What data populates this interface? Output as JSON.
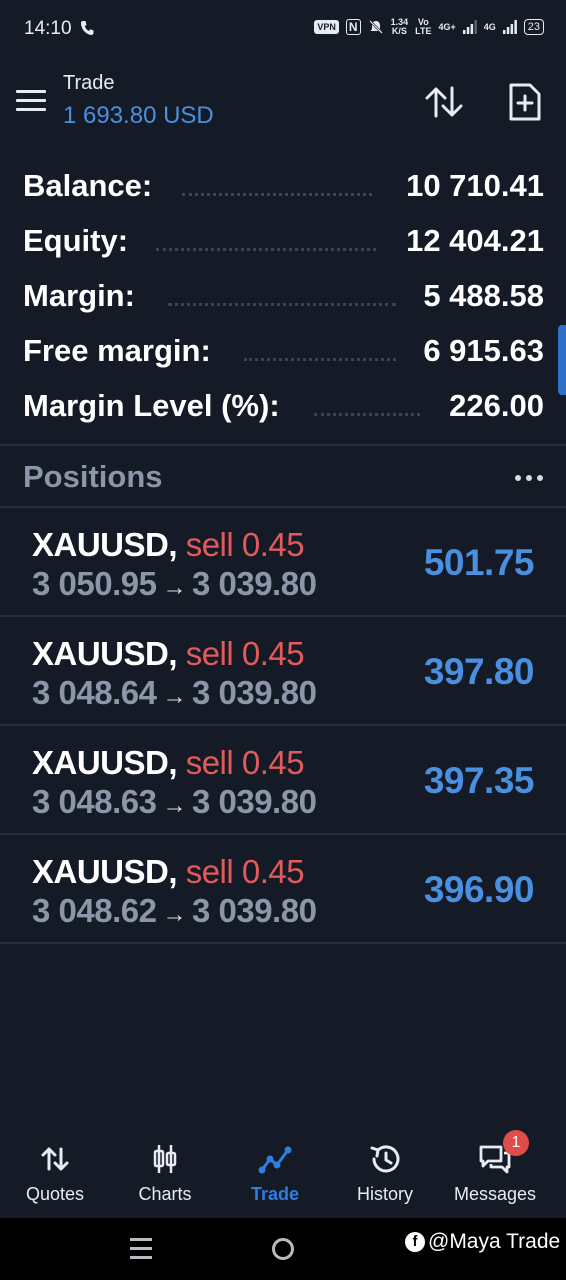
{
  "status_bar": {
    "time": "14:10",
    "vpn": "VPN",
    "nfc": "N",
    "speed_value": "1.34",
    "speed_unit": "K/S",
    "volte_top": "Vo",
    "volte_bottom": "LTE",
    "network_1": "4G+",
    "network_2": "4G",
    "battery": "23"
  },
  "header": {
    "title": "Trade",
    "subtitle": "1 693.80 USD"
  },
  "summary": [
    {
      "label": "Balance:",
      "value": "10 710.41"
    },
    {
      "label": "Equity:",
      "value": "12 404.21"
    },
    {
      "label": "Margin:",
      "value": "5 488.58"
    },
    {
      "label": "Free margin:",
      "value": "6 915.63"
    },
    {
      "label": "Margin Level (%):",
      "value": "226.00"
    }
  ],
  "positions": {
    "title": "Positions",
    "items": [
      {
        "symbol": "XAUUSD,",
        "side": "sell 0.45",
        "open_price": "3 050.95",
        "arrow": "→",
        "current_price": "3 039.80",
        "profit": "501.75"
      },
      {
        "symbol": "XAUUSD,",
        "side": "sell 0.45",
        "open_price": "3 048.64",
        "arrow": "→",
        "current_price": "3 039.80",
        "profit": "397.80"
      },
      {
        "symbol": "XAUUSD,",
        "side": "sell 0.45",
        "open_price": "3 048.63",
        "arrow": "→",
        "current_price": "3 039.80",
        "profit": "397.35"
      },
      {
        "symbol": "XAUUSD,",
        "side": "sell 0.45",
        "open_price": "3 048.62",
        "arrow": "→",
        "current_price": "3 039.80",
        "profit": "396.90"
      }
    ]
  },
  "bottom_nav": [
    {
      "label": "Quotes",
      "icon": "quotes-icon"
    },
    {
      "label": "Charts",
      "icon": "charts-icon"
    },
    {
      "label": "Trade",
      "icon": "trade-icon",
      "active": true
    },
    {
      "label": "History",
      "icon": "history-icon"
    },
    {
      "label": "Messages",
      "icon": "messages-icon",
      "badge": "1"
    }
  ],
  "watermark": {
    "logo": "f",
    "text": "@Maya Trade"
  },
  "colors": {
    "background": "#141b27",
    "accent_blue": "#4a8fe0",
    "sell_red": "#e35a5a",
    "muted_gray": "#8b97a8",
    "badge_red": "#e04b4b"
  }
}
